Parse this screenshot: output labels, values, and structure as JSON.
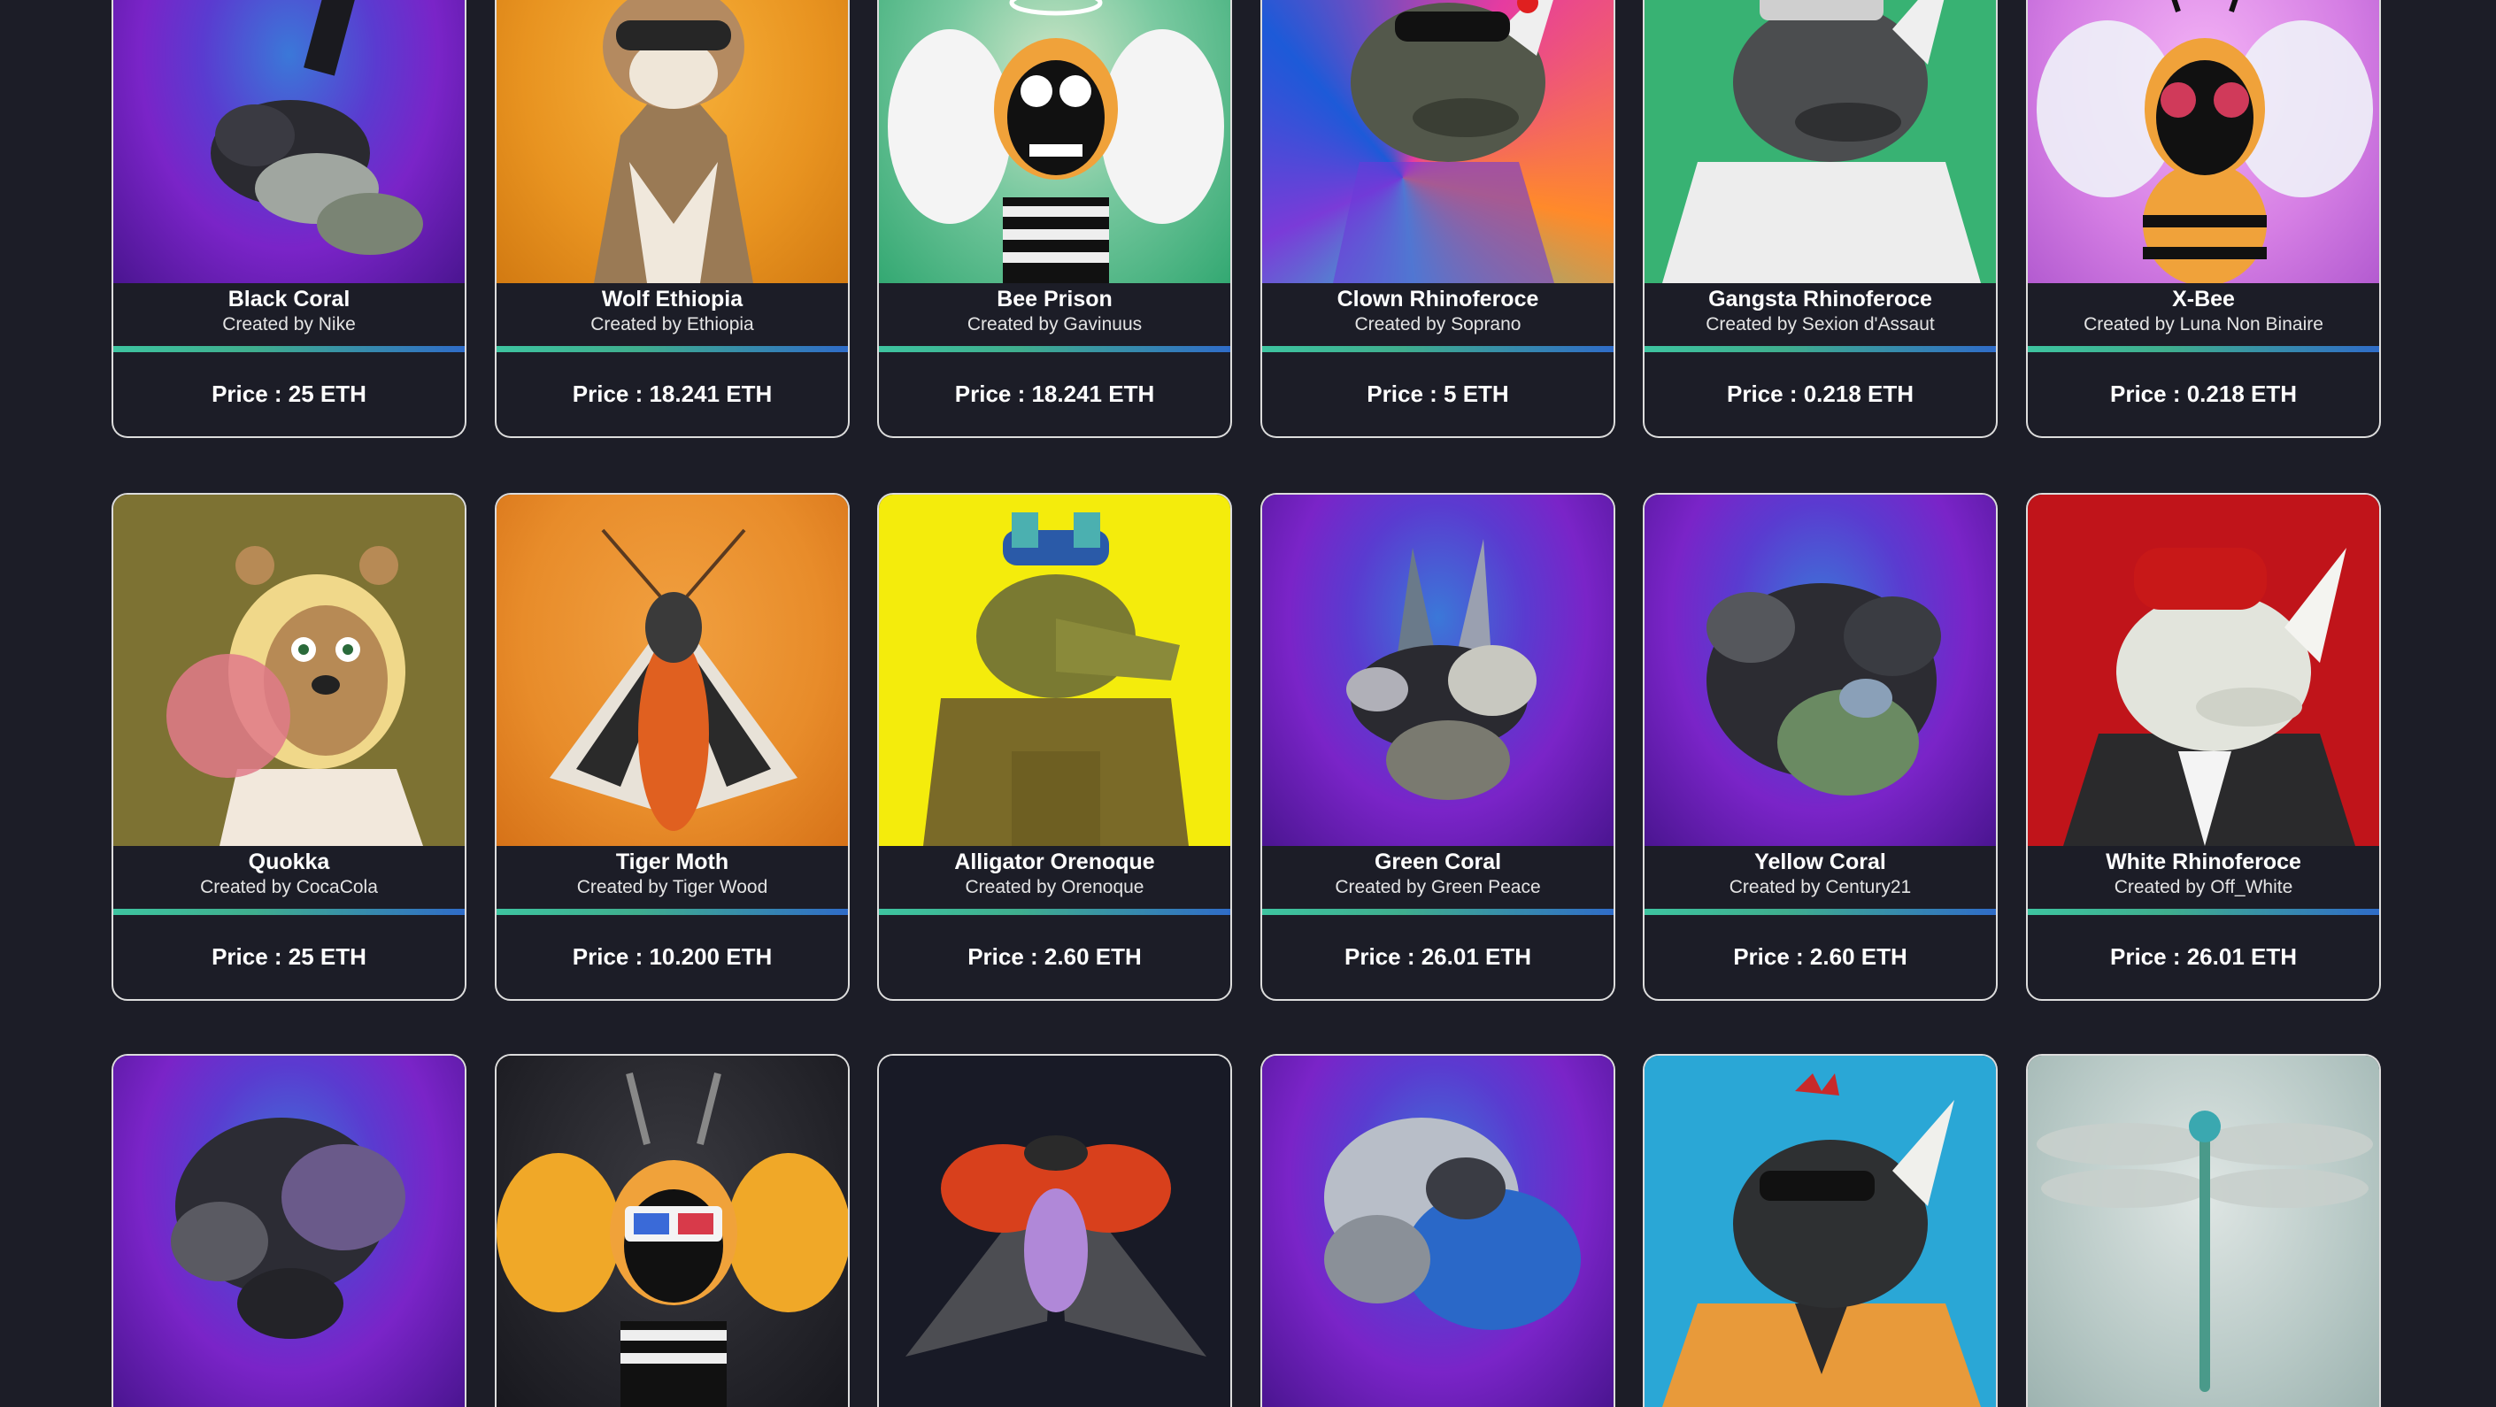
{
  "price_prefix": "Price : ",
  "cards": [
    {
      "title": "Black Coral",
      "creator": "Created by Nike",
      "price": "Price : 25 ETH",
      "art": "coral-icon"
    },
    {
      "title": "Wolf Ethiopia",
      "creator": "Created by Ethiopia",
      "price": "Price : 18.241 ETH",
      "art": "wolf-icon"
    },
    {
      "title": "Bee Prison",
      "creator": "Created by Gavinuus",
      "price": "Price : 18.241 ETH",
      "art": "bee-icon"
    },
    {
      "title": "Clown Rhinoferoce",
      "creator": "Created by Soprano",
      "price": "Price : 5 ETH",
      "art": "rhino-icon"
    },
    {
      "title": "Gangsta Rhinoferoce",
      "creator": "Created by Sexion d'Assaut",
      "price": "Price : 0.218 ETH",
      "art": "rhino-icon"
    },
    {
      "title": "X-Bee",
      "creator": "Created by Luna Non Binaire",
      "price": "Price : 0.218 ETH",
      "art": "bee-icon"
    },
    {
      "title": "Quokka",
      "creator": "Created by CocaCola",
      "price": "Price : 25 ETH",
      "art": "quokka-icon"
    },
    {
      "title": "Tiger Moth",
      "creator": "Created by Tiger Wood",
      "price": "Price : 10.200 ETH",
      "art": "moth-icon"
    },
    {
      "title": "Alligator Orenoque",
      "creator": "Created by Orenoque",
      "price": "Price : 2.60 ETH",
      "art": "alligator-icon"
    },
    {
      "title": "Green Coral",
      "creator": "Created by Green Peace",
      "price": "Price : 26.01 ETH",
      "art": "coral-icon"
    },
    {
      "title": "Yellow Coral",
      "creator": "Created by Century21",
      "price": "Price : 2.60 ETH",
      "art": "coral-icon"
    },
    {
      "title": "White Rhinoferoce",
      "creator": "Created by Off_White",
      "price": "Price : 26.01 ETH",
      "art": "rhino-icon"
    },
    {
      "art": "coral-icon"
    },
    {
      "art": "bee-icon"
    },
    {
      "art": "ladybug-icon"
    },
    {
      "art": "coral-icon"
    },
    {
      "art": "rhino-icon"
    },
    {
      "art": "dragonfly-icon"
    }
  ],
  "colors": {
    "page_bg": "#1c1d27",
    "card_border": "#dcdcdc",
    "bar_start": "#3ec4a0",
    "bar_end": "#2f6cc8"
  }
}
